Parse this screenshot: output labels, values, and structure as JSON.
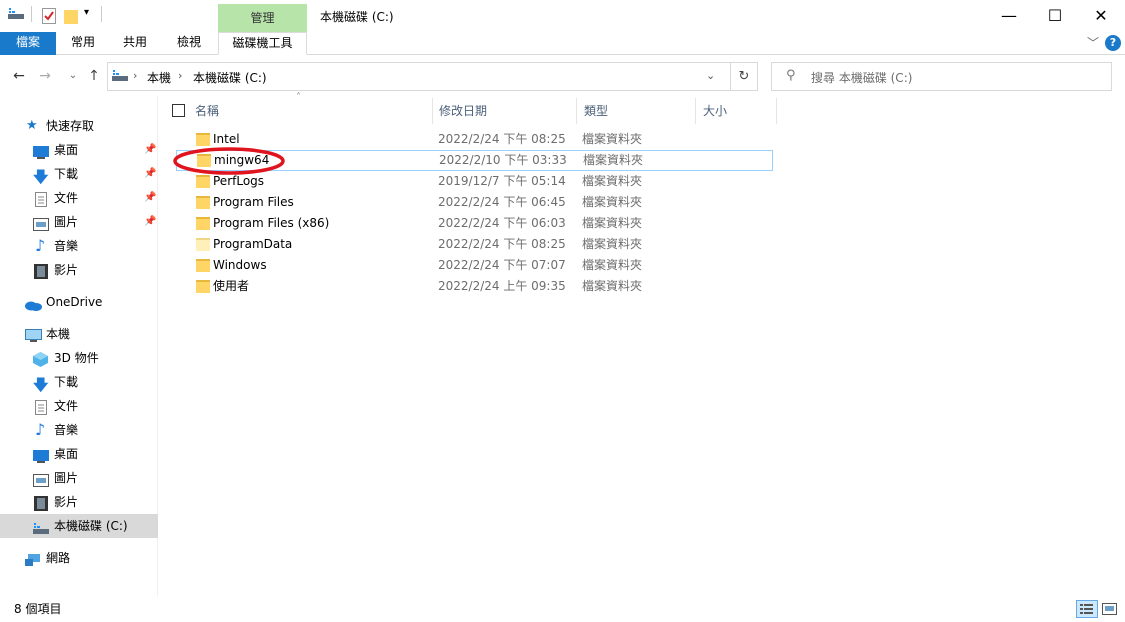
{
  "window": {
    "title": "本機磁碟 (C:)",
    "context_tab": "管理"
  },
  "ribbon": {
    "tabs": [
      "檔案",
      "常用",
      "共用",
      "檢視",
      "磁碟機工具"
    ]
  },
  "address": {
    "crumbs": [
      "本機",
      "本機磁碟 (C:)"
    ],
    "search_placeholder": "搜尋 本機磁碟 (C:)"
  },
  "sidebar": {
    "quick_access": "快速存取",
    "quick_items": [
      "桌面",
      "下載",
      "文件",
      "圖片",
      "音樂",
      "影片"
    ],
    "onedrive": "OneDrive",
    "this_pc": "本機",
    "pc_items": [
      "3D 物件",
      "下載",
      "文件",
      "音樂",
      "桌面",
      "圖片",
      "影片",
      "本機磁碟 (C:)"
    ],
    "network": "網路"
  },
  "columns": [
    "名稱",
    "修改日期",
    "類型",
    "大小"
  ],
  "files": [
    {
      "name": "Intel",
      "date": "2022/2/24 下午 08:25",
      "type": "檔案資料夾"
    },
    {
      "name": "mingw64",
      "date": "2022/2/10 下午 03:33",
      "type": "檔案資料夾"
    },
    {
      "name": "PerfLogs",
      "date": "2019/12/7 下午 05:14",
      "type": "檔案資料夾"
    },
    {
      "name": "Program Files",
      "date": "2022/2/24 下午 06:45",
      "type": "檔案資料夾"
    },
    {
      "name": "Program Files (x86)",
      "date": "2022/2/24 下午 06:03",
      "type": "檔案資料夾"
    },
    {
      "name": "ProgramData",
      "date": "2022/2/24 下午 08:25",
      "type": "檔案資料夾"
    },
    {
      "name": "Windows",
      "date": "2022/2/24 下午 07:07",
      "type": "檔案資料夾"
    },
    {
      "name": "使用者",
      "date": "2022/2/24 上午 09:35",
      "type": "檔案資料夾"
    }
  ],
  "status": {
    "count": "8 個項目"
  },
  "colors": {
    "accent": "#1979ca",
    "context_tab": "#b7e4a8",
    "highlight_circle": "#e0141e"
  }
}
